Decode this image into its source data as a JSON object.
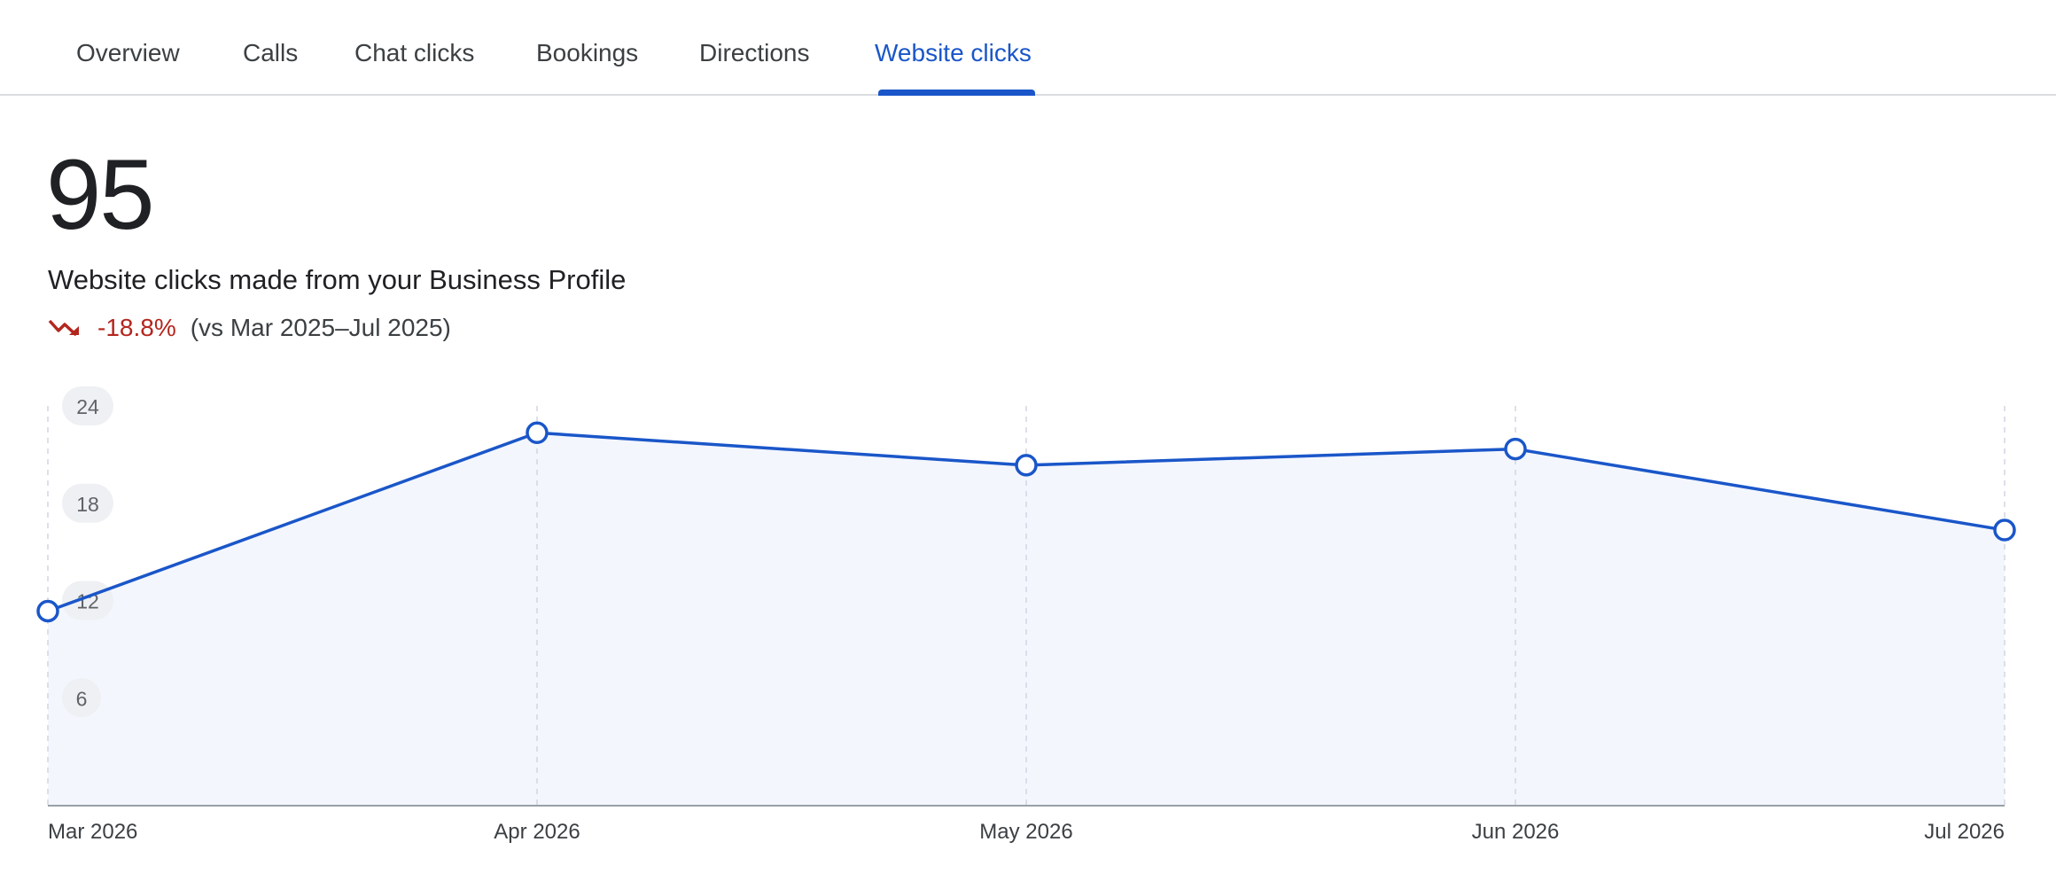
{
  "tabs": {
    "overview": "Overview",
    "calls": "Calls",
    "chat_clicks": "Chat clicks",
    "bookings": "Bookings",
    "directions": "Directions",
    "website_clicks": "Website clicks",
    "active": "Website clicks"
  },
  "summary": {
    "total": "95",
    "description": "Website clicks made from your Business Profile",
    "change": "-18.8%",
    "comparison": "(vs Mar 2025–Jul 2025)",
    "trend_icon": "trending-down-icon"
  },
  "colors": {
    "accent": "#1a56c9",
    "negative": "#b3261e",
    "area_fill": "#f3f6fd"
  },
  "chart_data": {
    "type": "line",
    "x": [
      "Mar 2026",
      "Apr 2026",
      "May 2026",
      "Jun 2026",
      "Jul 2026"
    ],
    "values": [
      12,
      23,
      21,
      22,
      17
    ],
    "y_ticks": [
      6,
      12,
      18,
      24
    ],
    "ylim": [
      0,
      24
    ],
    "fill_area": true,
    "markers": "hollow-circle",
    "vertical_gridlines": "dashed"
  }
}
